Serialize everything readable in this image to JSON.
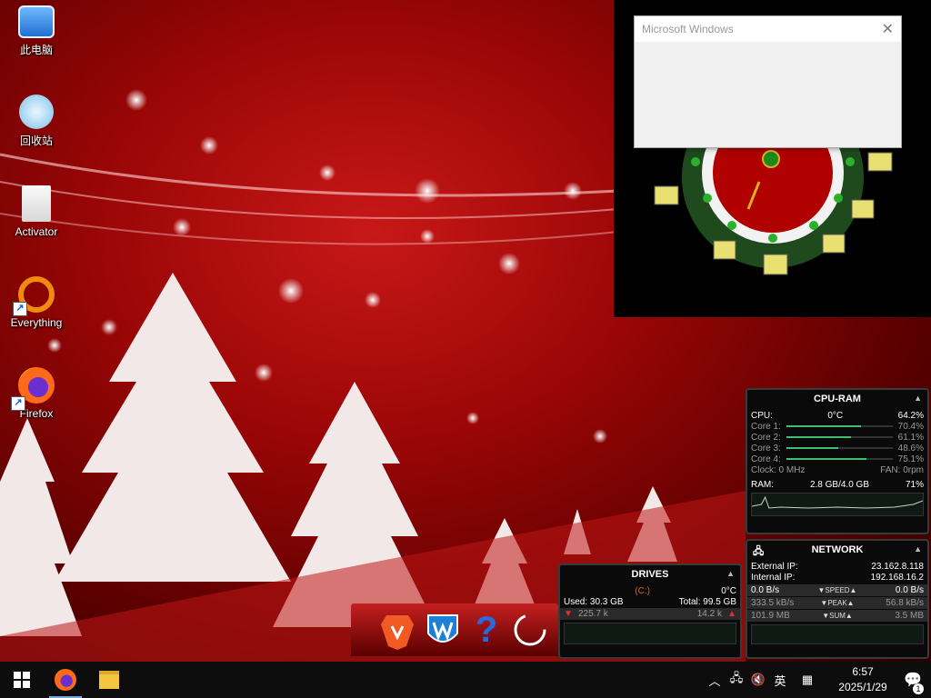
{
  "desktop": {
    "icons": [
      {
        "label": "此电脑",
        "icon": "computer-icon"
      },
      {
        "label": "回收站",
        "icon": "recycle-bin-icon"
      },
      {
        "label": "Activator",
        "icon": "file-icon"
      },
      {
        "label": "Everything",
        "icon": "everything-icon"
      },
      {
        "label": "Firefox",
        "icon": "firefox-icon"
      }
    ]
  },
  "dialog": {
    "title": "Microsoft Windows",
    "close": "✕"
  },
  "cpu_ram": {
    "title": "CPU-RAM",
    "cpu_label": "CPU:",
    "cpu_temp": "0°C",
    "cpu_pct": "64.2%",
    "cores": [
      {
        "label": "Core 1:",
        "value": "70.4%",
        "level": 0.704
      },
      {
        "label": "Core 2:",
        "value": "61.1%",
        "level": 0.611
      },
      {
        "label": "Core 3:",
        "value": "48.6%",
        "level": 0.486
      },
      {
        "label": "Core 4:",
        "value": "75.1%",
        "level": 0.751
      }
    ],
    "clock": "Clock: 0 MHz",
    "fan": "FAN: 0rpm",
    "ram_label": "RAM:",
    "ram_used": "2.8 GB/4.0 GB",
    "ram_pct": "71%"
  },
  "network": {
    "title": "NETWORK",
    "external_label": "External IP:",
    "external_ip": "23.162.8.118",
    "internal_label": "Internal IP:",
    "internal_ip": "192.168.16.2",
    "speed": {
      "down": "0.0 B/s",
      "label": "▼SPEED▲",
      "up": "0.0 B/s"
    },
    "peak": {
      "down": "333.5 kB/s",
      "label": "▼PEAK▲",
      "up": "56.8 kB/s"
    },
    "sum": {
      "down": "101.9 MB",
      "label": "▼SUM▲",
      "up": "3.5 MB"
    }
  },
  "drives": {
    "title": "DRIVES",
    "drive": "(C:)",
    "temp": "0°C",
    "used": "Used: 30.3 GB",
    "total": "Total: 99.5 GB",
    "read": "225.7 k",
    "write": "14.2 k"
  },
  "taskbar": {
    "apps": [
      "windows-start-icon",
      "firefox-icon",
      "file-explorer-icon"
    ],
    "ime": "英",
    "time": "6:57",
    "date": "2025/1/29",
    "notifications": "1"
  },
  "colors": {
    "accent": "#3fbf6f",
    "wallpaper": "#b01010",
    "drive_label": "#e06020"
  }
}
